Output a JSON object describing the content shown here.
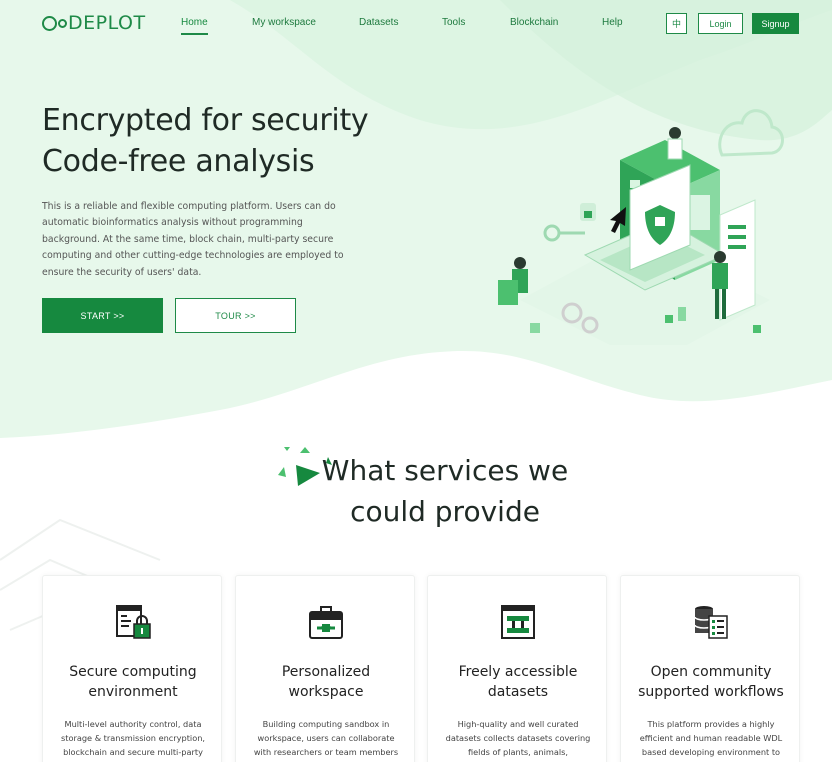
{
  "brand": {
    "logo_text": "DEPLOT",
    "accent_color": "#16893f",
    "hero_bg_color": "#e8f8ec"
  },
  "nav": {
    "items": [
      {
        "label": "Home",
        "active": true
      },
      {
        "label": "My workspace",
        "active": false
      },
      {
        "label": "Datasets",
        "active": false
      },
      {
        "label": "Tools",
        "active": false
      },
      {
        "label": "Blockchain",
        "active": false
      },
      {
        "label": "Help",
        "active": false
      }
    ],
    "lang_label": "中",
    "login_label": "Login",
    "signup_label": "Signup"
  },
  "hero": {
    "title_line1": "Encrypted for security",
    "title_line2": "Code-free analysis",
    "desc_lines": [
      "This is a reliable and flexible computing platform. Users can do",
      "automatic bioinformatics analysis without programming",
      "background. At the same time, block chain, multi-party secure",
      "computing and other cutting-edge technologies are employed to",
      "ensure the security of users' data."
    ],
    "start_label": "START >>",
    "tour_label": "TOUR >>"
  },
  "services": {
    "title_line1": "What services we",
    "title_line2": "could provide",
    "cards": [
      {
        "icon": "secure-document-lock-icon",
        "title_line1": "Secure computing",
        "title_line2": "environment",
        "desc_lines": [
          "Multi-level authority control, data",
          "storage & transmission encryption,",
          "blockchain and secure multi-party"
        ]
      },
      {
        "icon": "toolbox-icon",
        "title_line1": "Personalized",
        "title_line2": "workspace",
        "desc_lines": [
          "Building computing sandbox in",
          "workspace, users can collaborate",
          "with researchers or team members"
        ]
      },
      {
        "icon": "dataset-window-icon",
        "title_line1": "Freely accessible",
        "title_line2": "datasets",
        "desc_lines": [
          "High-quality and well curated",
          "datasets collects datasets covering",
          "fields of plants, animals,"
        ]
      },
      {
        "icon": "database-workflow-icon",
        "title_line1": "Open community",
        "title_line2": "supported workflows",
        "desc_lines": [
          "This platform provides a highly",
          "efficient and human readable WDL",
          "based developing environment to"
        ]
      }
    ]
  }
}
